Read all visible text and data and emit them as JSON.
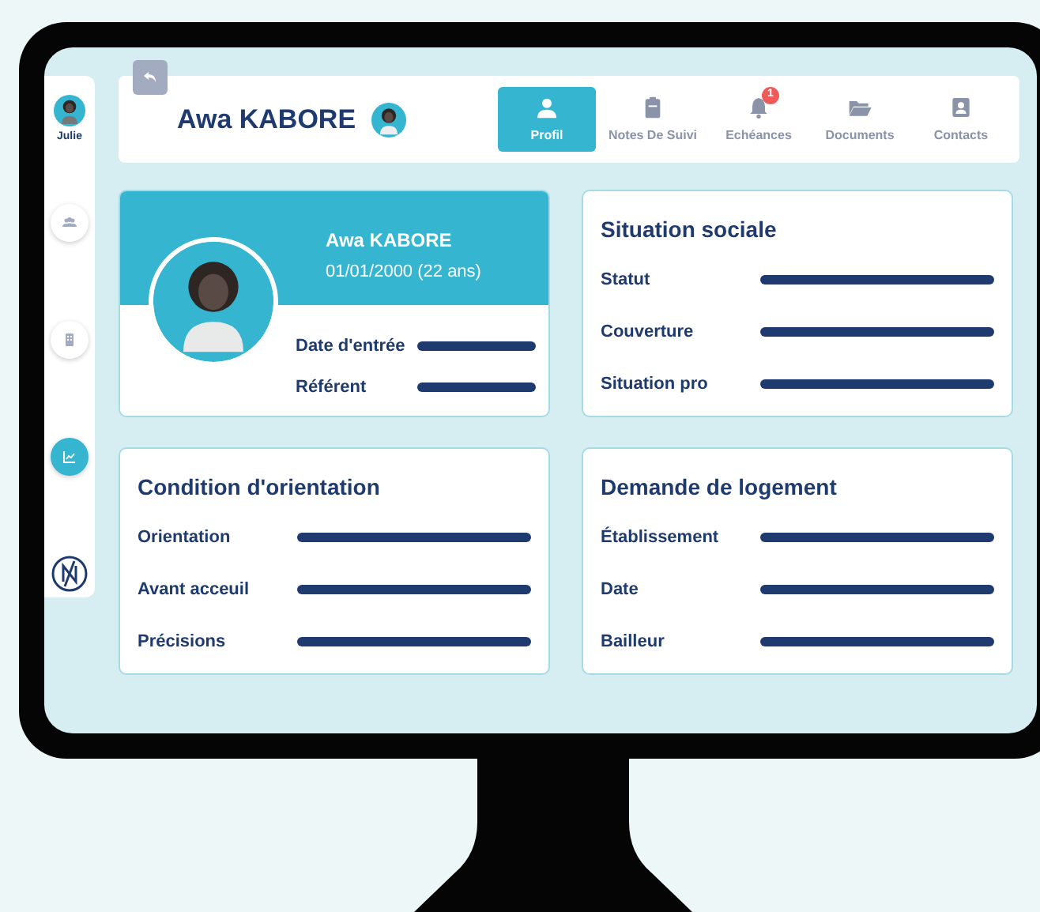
{
  "sidebar": {
    "user": {
      "name": "Julie"
    },
    "items": [
      {
        "kind": "people",
        "selected": false
      },
      {
        "kind": "building",
        "selected": false
      },
      {
        "kind": "chart",
        "selected": true
      },
      {
        "kind": "logo",
        "selected": false
      }
    ]
  },
  "header": {
    "name": "Awa KABORE",
    "tabs": [
      {
        "kind": "person",
        "label": "Profil",
        "selected": true
      },
      {
        "kind": "clipboard",
        "label": "Notes De Suivi",
        "selected": false
      },
      {
        "kind": "bell",
        "label": "Echéances",
        "selected": false,
        "badge": "1"
      },
      {
        "kind": "folder",
        "label": "Documents",
        "selected": false
      },
      {
        "kind": "contact",
        "label": "Contacts",
        "selected": false
      }
    ]
  },
  "profile": {
    "name": "Awa KABORE",
    "birth": "01/01/2000 (22 ans)",
    "fields": [
      "Date d'entrée",
      "Référent"
    ]
  },
  "cards": [
    {
      "title": "Situation sociale",
      "fields": [
        "Statut",
        "Couverture",
        "Situation pro"
      ]
    },
    {
      "title": "Condition d'orientation",
      "fields": [
        "Orientation",
        "Avant acceuil",
        "Précisions"
      ]
    },
    {
      "title": "Demande de logement",
      "fields": [
        "Établissement",
        "Date",
        "Bailleur"
      ]
    }
  ]
}
